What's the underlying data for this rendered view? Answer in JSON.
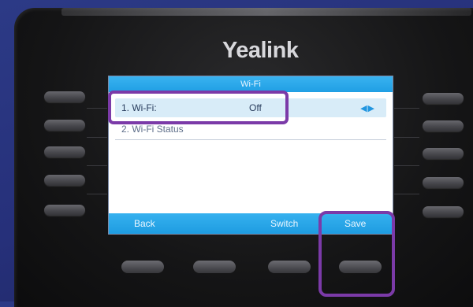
{
  "brand": "Yealink",
  "screen": {
    "title": "Wi-Fi",
    "items": [
      {
        "label": "1. Wi-Fi:",
        "value": "Off",
        "arrows": "◀▶"
      },
      {
        "label": "2. Wi-Fi Status"
      }
    ],
    "softkeys": {
      "back": "Back",
      "switch": "Switch",
      "save": "Save"
    }
  },
  "colors": {
    "screen_accent": "#1f9fe4",
    "highlight_ring": "#7b3aa8"
  }
}
